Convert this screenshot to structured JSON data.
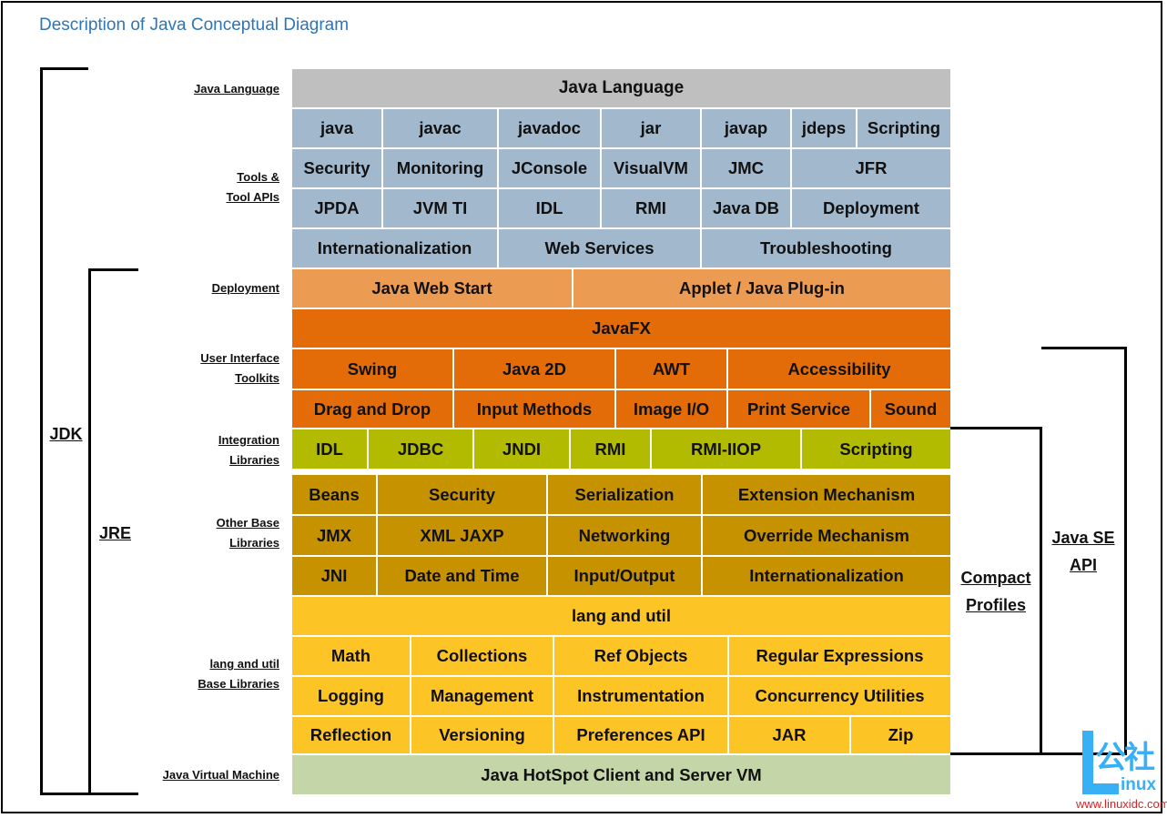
{
  "title": "Description of Java Conceptual Diagram",
  "left_labels": {
    "java_language": [
      "Java Language"
    ],
    "tools": [
      "Tools &",
      "Tool APIs"
    ],
    "deployment": [
      "Deployment"
    ],
    "ui_toolkits": [
      "User Interface",
      "Toolkits"
    ],
    "integration": [
      "Integration",
      "Libraries"
    ],
    "other_base": [
      "Other Base",
      "Libraries"
    ],
    "lang_util": [
      "lang and util",
      "Base Libraries"
    ],
    "jvm": [
      "Java Virtual Machine"
    ]
  },
  "brackets": {
    "jdk": "JDK",
    "jre": "JRE",
    "compact_profiles": [
      "Compact",
      "Profiles"
    ],
    "java_se_api": [
      "Java SE",
      "API"
    ]
  },
  "rows": {
    "java_language": [
      "Java Language"
    ],
    "tools1": [
      "java",
      "javac",
      "javadoc",
      "jar",
      "javap",
      "jdeps",
      "Scripting"
    ],
    "tools2": [
      "Security",
      "Monitoring",
      "JConsole",
      "VisualVM",
      "JMC",
      "JFR"
    ],
    "tools3": [
      "JPDA",
      "JVM TI",
      "IDL",
      "RMI",
      "Java DB",
      "Deployment"
    ],
    "tools4": [
      "Internationalization",
      "Web Services",
      "Troubleshooting"
    ],
    "deployment": [
      "Java Web Start",
      "Applet / Java Plug-in"
    ],
    "javafx": [
      "JavaFX"
    ],
    "ui1": [
      "Swing",
      "Java 2D",
      "AWT",
      "Accessibility"
    ],
    "ui2": [
      "Drag and Drop",
      "Input Methods",
      "Image I/O",
      "Print Service",
      "Sound"
    ],
    "integration": [
      "IDL",
      "JDBC",
      "JNDI",
      "RMI",
      "RMI-IIOP",
      "Scripting"
    ],
    "other1": [
      "Beans",
      "Security",
      "Serialization",
      "Extension Mechanism"
    ],
    "other2": [
      "JMX",
      "XML JAXP",
      "Networking",
      "Override Mechanism"
    ],
    "other3": [
      "JNI",
      "Date and Time",
      "Input/Output",
      "Internationalization"
    ],
    "lang_util": [
      "lang and util"
    ],
    "lu1": [
      "Math",
      "Collections",
      "Ref Objects",
      "Regular Expressions"
    ],
    "lu2": [
      "Logging",
      "Management",
      "Instrumentation",
      "Concurrency Utilities"
    ],
    "lu3": [
      "Reflection",
      "Versioning",
      "Preferences API",
      "JAR",
      "Zip"
    ],
    "jvm": [
      "Java HotSpot Client and Server VM"
    ]
  },
  "colors": {
    "title": "#2e75b6",
    "java_language": "#bfbfbf",
    "tools": "#a2b8cc",
    "deployment": "#ec9b53",
    "ui": "#e36c09",
    "integration": "#b3bb00",
    "other_base": "#c79200",
    "lang_util": "#fdc425",
    "jvm": "#c4d5a8"
  },
  "watermark": {
    "chinese": "公社",
    "word": "inux",
    "url": "www.linuxidc.com"
  }
}
